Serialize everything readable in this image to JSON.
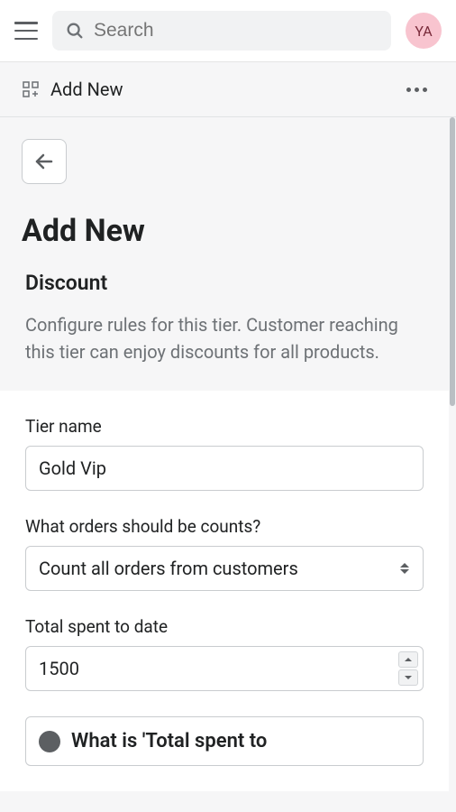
{
  "topbar": {
    "search_placeholder": "Search",
    "avatar_initials": "YA"
  },
  "subheader": {
    "title": "Add New"
  },
  "page": {
    "title": "Add New",
    "section_label": "Discount",
    "section_desc": "Configure rules for this tier. Customer reaching this tier can enjoy discounts for all products."
  },
  "form": {
    "tier_name": {
      "label": "Tier name",
      "value": "Gold Vip"
    },
    "order_count": {
      "label": "What orders should be counts?",
      "value": "Count all orders from customers"
    },
    "total_spent": {
      "label": "Total spent to date",
      "value": "1500"
    },
    "info_heading_partial": "What is 'Total spent to"
  }
}
